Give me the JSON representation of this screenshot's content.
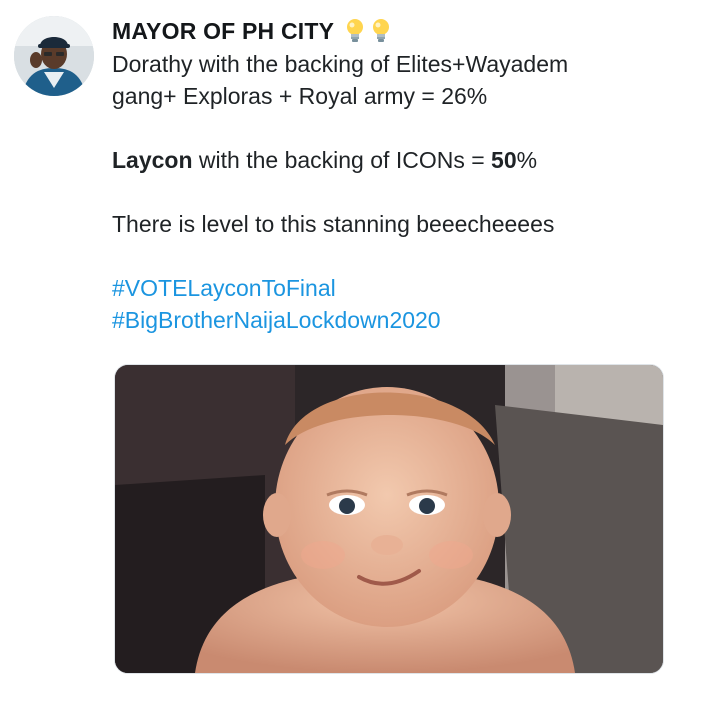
{
  "author": {
    "display_name": "MAYOR OF PH CITY",
    "name_emojis": [
      "light-bulb-icon",
      "light-bulb-icon"
    ],
    "avatar_icon": "profile-photo-man-in-cap"
  },
  "tweet": {
    "line1": "Dorathy with the backing of Elites+Wayadem",
    "line2": "gang+ Exploras + Royal army = 26%",
    "laycon_name": "Laycon",
    "laycon_mid": " with the backing of ICONs = ",
    "laycon_value": "50",
    "laycon_suffix": "%",
    "line4": "There is level to this stanning beeecheeees",
    "hashtags": [
      "#VOTELayconToFinal",
      "#BigBrotherNaijaLockdown2020"
    ]
  },
  "media": {
    "description_icon": "smirking-baby-photo"
  },
  "colors": {
    "hashtag": "#1b95e0",
    "text": "#14171a"
  }
}
